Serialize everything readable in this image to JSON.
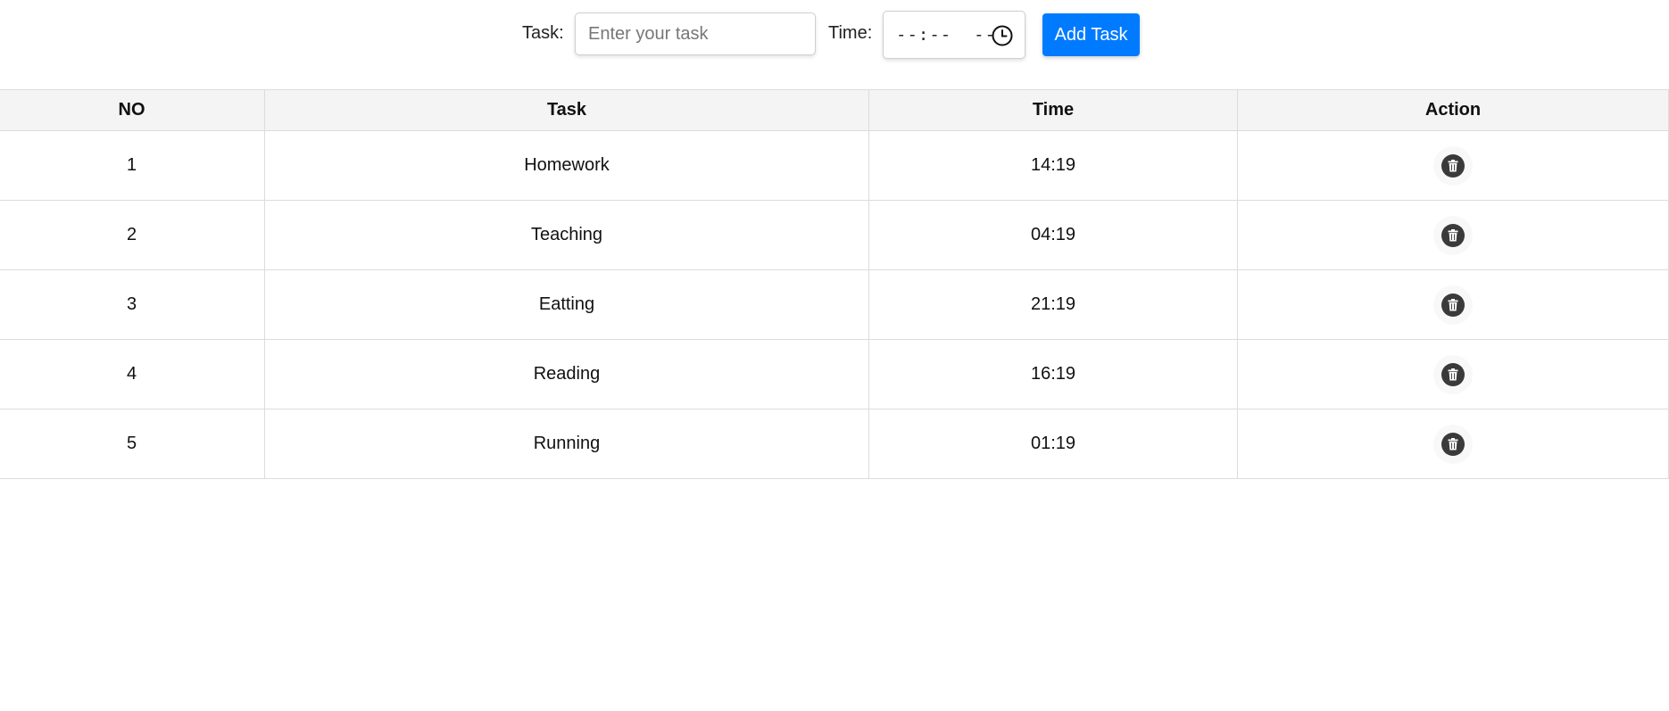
{
  "form": {
    "task_label": "Task:",
    "task_placeholder": "Enter your task",
    "task_value": "",
    "time_label": "Time:",
    "time_placeholder": "--:--  --",
    "add_button_label": "Add Task",
    "accent_color": "#007bff"
  },
  "table": {
    "headers": [
      "NO",
      "Task",
      "Time",
      "Action"
    ],
    "rows": [
      {
        "no": "1",
        "task": "Homework",
        "time": "14:19",
        "action_icon": "trash-icon"
      },
      {
        "no": "2",
        "task": "Teaching",
        "time": "04:19",
        "action_icon": "trash-icon"
      },
      {
        "no": "3",
        "task": "Eatting",
        "time": "21:19",
        "action_icon": "trash-icon"
      },
      {
        "no": "4",
        "task": "Reading",
        "time": "16:19",
        "action_icon": "trash-icon"
      },
      {
        "no": "5",
        "task": "Running",
        "time": "01:19",
        "action_icon": "trash-icon"
      }
    ]
  }
}
